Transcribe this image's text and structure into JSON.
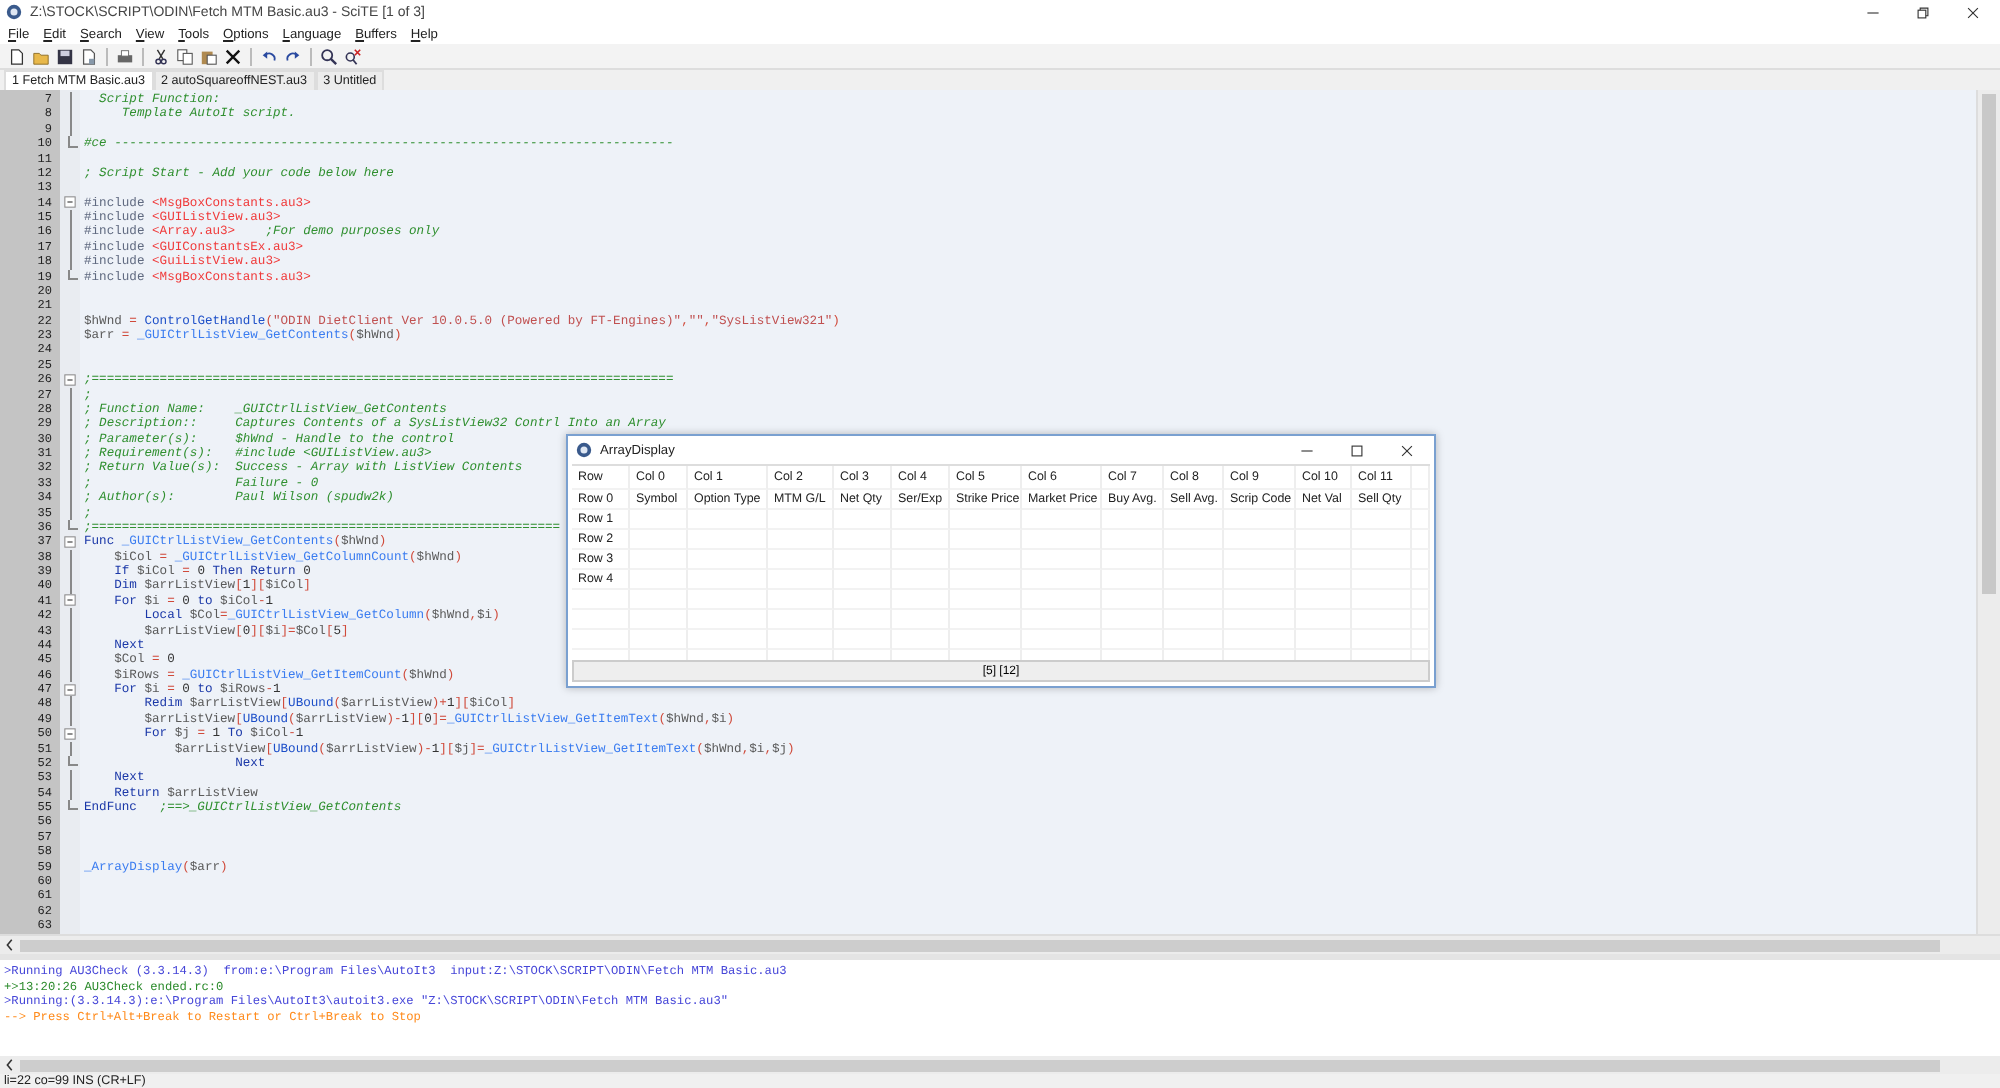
{
  "window": {
    "title": "Z:\\STOCK\\SCRIPT\\ODIN\\Fetch MTM Basic.au3 - SciTE [1 of 3]"
  },
  "menu": [
    "File",
    "Edit",
    "Search",
    "View",
    "Tools",
    "Options",
    "Language",
    "Buffers",
    "Help"
  ],
  "tabs": [
    {
      "label": "1 Fetch MTM Basic.au3",
      "selected": true
    },
    {
      "label": "2 autoSquareoffNEST.au3",
      "selected": false
    },
    {
      "label": "3 Untitled",
      "selected": false
    }
  ],
  "editor": {
    "lines": [
      {
        "num": "7",
        "kind": "fold_body",
        "tokens": [
          {
            "kind": "c",
            "text": "  Script Function:"
          }
        ]
      },
      {
        "num": "8",
        "kind": "fold_body",
        "tokens": [
          {
            "kind": "c",
            "text": "     Template AutoIt script."
          }
        ]
      },
      {
        "num": "9",
        "kind": "fold_body"
      },
      {
        "num": "10",
        "kind": "fold_end",
        "tokens": [
          {
            "kind": "c",
            "text": "#ce --------------------------------------------------------------------------"
          }
        ]
      },
      {
        "num": "11",
        "kind": "plain"
      },
      {
        "num": "12",
        "kind": "plain",
        "tokens": [
          {
            "kind": "c",
            "text": "; Script Start - Add your code below here"
          }
        ]
      },
      {
        "num": "13",
        "kind": "plain"
      },
      {
        "num": "14",
        "kind": "fold_start",
        "tokens": [
          {
            "kind": "d",
            "text": "#include "
          },
          {
            "kind": "inc",
            "text": "<MsgBoxConstants.au3>"
          }
        ]
      },
      {
        "num": "15",
        "kind": "fold_body",
        "tokens": [
          {
            "kind": "d",
            "text": "#include "
          },
          {
            "kind": "inc",
            "text": "<GUIListView.au3>"
          }
        ]
      },
      {
        "num": "16",
        "kind": "fold_body",
        "tokens": [
          {
            "kind": "d",
            "text": "#include "
          },
          {
            "kind": "inc",
            "text": "<Array.au3>"
          },
          {
            "kind": "c",
            "text": "    ;For demo purposes only"
          }
        ]
      },
      {
        "num": "17",
        "kind": "fold_body",
        "tokens": [
          {
            "kind": "d",
            "text": "#include "
          },
          {
            "kind": "inc",
            "text": "<GUIConstantsEx.au3>"
          }
        ]
      },
      {
        "num": "18",
        "kind": "fold_body",
        "tokens": [
          {
            "kind": "d",
            "text": "#include "
          },
          {
            "kind": "inc",
            "text": "<GuiListView.au3>"
          }
        ]
      },
      {
        "num": "19",
        "kind": "fold_end",
        "tokens": [
          {
            "kind": "d",
            "text": "#include "
          },
          {
            "kind": "inc",
            "text": "<MsgBoxConstants.au3>"
          }
        ]
      },
      {
        "num": "20",
        "kind": "plain"
      },
      {
        "num": "21",
        "kind": "plain"
      },
      {
        "num": "22",
        "kind": "plain",
        "tokens": [
          {
            "kind": "v",
            "text": "$hWnd"
          },
          {
            "kind": "o",
            "text": " = "
          },
          {
            "kind": "f",
            "text": "ControlGetHandle"
          },
          {
            "kind": "o",
            "text": "("
          },
          {
            "kind": "s",
            "text": "\"ODIN DietClient Ver 10.0.5.0 (Powered by FT-Engines)\""
          },
          {
            "kind": "o",
            "text": ","
          },
          {
            "kind": "s",
            "text": "\"\""
          },
          {
            "kind": "o",
            "text": ","
          },
          {
            "kind": "s",
            "text": "\"SysListView321\""
          },
          {
            "kind": "o",
            "text": ")"
          }
        ]
      },
      {
        "num": "23",
        "kind": "plain",
        "tokens": [
          {
            "kind": "v",
            "text": "$arr"
          },
          {
            "kind": "o",
            "text": " = "
          },
          {
            "kind": "u",
            "text": "_GUICtrlListView_GetContents"
          },
          {
            "kind": "o",
            "text": "("
          },
          {
            "kind": "v",
            "text": "$hWnd"
          },
          {
            "kind": "o",
            "text": ")"
          }
        ]
      },
      {
        "num": "24",
        "kind": "plain"
      },
      {
        "num": "25",
        "kind": "plain"
      },
      {
        "num": "26",
        "kind": "fold_start",
        "tokens": [
          {
            "kind": "c",
            "text": ";============================================================================="
          }
        ]
      },
      {
        "num": "27",
        "kind": "fold_body",
        "tokens": [
          {
            "kind": "c",
            "text": ";"
          }
        ]
      },
      {
        "num": "28",
        "kind": "fold_body",
        "tokens": [
          {
            "kind": "c",
            "text": "; Function Name:    _GUICtrlListView_GetContents"
          }
        ]
      },
      {
        "num": "29",
        "kind": "fold_body",
        "tokens": [
          {
            "kind": "c",
            "text": "; Description::     Captures Contents of a SysListView32 Contrl Into an Array"
          }
        ]
      },
      {
        "num": "30",
        "kind": "fold_body",
        "tokens": [
          {
            "kind": "c",
            "text": "; Parameter(s):     $hWnd - Handle to the control"
          }
        ]
      },
      {
        "num": "31",
        "kind": "fold_body",
        "tokens": [
          {
            "kind": "c",
            "text": "; Requirement(s):   #include <GUIListView.au3>"
          }
        ]
      },
      {
        "num": "32",
        "kind": "fold_body",
        "tokens": [
          {
            "kind": "c",
            "text": "; Return Value(s):  Success - Array with ListView Contents"
          }
        ]
      },
      {
        "num": "33",
        "kind": "fold_body",
        "tokens": [
          {
            "kind": "c",
            "text": ";                   Failure - 0"
          }
        ]
      },
      {
        "num": "34",
        "kind": "fold_body",
        "tokens": [
          {
            "kind": "c",
            "text": "; Author(s):        Paul Wilson (spudw2k)"
          }
        ]
      },
      {
        "num": "35",
        "kind": "fold_body",
        "tokens": [
          {
            "kind": "c",
            "text": ";"
          }
        ]
      },
      {
        "num": "36",
        "kind": "fold_end",
        "tokens": [
          {
            "kind": "c",
            "text": ";=============================================================="
          }
        ]
      },
      {
        "num": "37",
        "kind": "fold_start",
        "tokens": [
          {
            "kind": "k",
            "text": "Func "
          },
          {
            "kind": "u",
            "text": "_GUICtrlListView_GetContents"
          },
          {
            "kind": "o",
            "text": "("
          },
          {
            "kind": "v",
            "text": "$hWnd"
          },
          {
            "kind": "o",
            "text": ")"
          }
        ]
      },
      {
        "num": "38",
        "kind": "fold_body",
        "tokens": [
          {
            "kind": "v",
            "text": "    $iCol"
          },
          {
            "kind": "o",
            "text": " = "
          },
          {
            "kind": "u",
            "text": "_GUICtrlListView_GetColumnCount"
          },
          {
            "kind": "o",
            "text": "("
          },
          {
            "kind": "v",
            "text": "$hWnd"
          },
          {
            "kind": "o",
            "text": ")"
          }
        ]
      },
      {
        "num": "39",
        "kind": "fold_body",
        "tokens": [
          {
            "kind": "k",
            "text": "    If "
          },
          {
            "kind": "v",
            "text": "$iCol"
          },
          {
            "kind": "o",
            "text": " = "
          },
          {
            "kind": "n",
            "text": "0"
          },
          {
            "kind": "k",
            "text": " Then Return "
          },
          {
            "kind": "n",
            "text": "0"
          }
        ]
      },
      {
        "num": "40",
        "kind": "fold_body",
        "tokens": [
          {
            "kind": "k",
            "text": "    Dim "
          },
          {
            "kind": "v",
            "text": "$arrListView"
          },
          {
            "kind": "o",
            "text": "["
          },
          {
            "kind": "n",
            "text": "1"
          },
          {
            "kind": "o",
            "text": "]["
          },
          {
            "kind": "v",
            "text": "$iCol"
          },
          {
            "kind": "o",
            "text": "]"
          }
        ]
      },
      {
        "num": "41",
        "kind": "fold_start",
        "tokens": [
          {
            "kind": "k",
            "text": "    For "
          },
          {
            "kind": "v",
            "text": "$i"
          },
          {
            "kind": "o",
            "text": " = "
          },
          {
            "kind": "n",
            "text": "0"
          },
          {
            "kind": "k",
            "text": " to "
          },
          {
            "kind": "v",
            "text": "$iCol"
          },
          {
            "kind": "o",
            "text": "-"
          },
          {
            "kind": "n",
            "text": "1"
          }
        ]
      },
      {
        "num": "42",
        "kind": "fold_body",
        "tokens": [
          {
            "kind": "k",
            "text": "        Local "
          },
          {
            "kind": "v",
            "text": "$Col"
          },
          {
            "kind": "o",
            "text": "="
          },
          {
            "kind": "u",
            "text": "_GUICtrlListView_GetColumn"
          },
          {
            "kind": "o",
            "text": "("
          },
          {
            "kind": "v",
            "text": "$hWnd"
          },
          {
            "kind": "o",
            "text": ","
          },
          {
            "kind": "v",
            "text": "$i"
          },
          {
            "kind": "o",
            "text": ")"
          }
        ]
      },
      {
        "num": "43",
        "kind": "fold_body",
        "tokens": [
          {
            "kind": "v",
            "text": "        $arrListView"
          },
          {
            "kind": "o",
            "text": "["
          },
          {
            "kind": "n",
            "text": "0"
          },
          {
            "kind": "o",
            "text": "]["
          },
          {
            "kind": "v",
            "text": "$i"
          },
          {
            "kind": "o",
            "text": "]="
          },
          {
            "kind": "v",
            "text": "$Col"
          },
          {
            "kind": "o",
            "text": "["
          },
          {
            "kind": "n",
            "text": "5"
          },
          {
            "kind": "o",
            "text": "]"
          }
        ]
      },
      {
        "num": "44",
        "kind": "fold_body",
        "tokens": [
          {
            "kind": "k",
            "text": "    Next"
          }
        ]
      },
      {
        "num": "45",
        "kind": "fold_body",
        "tokens": [
          {
            "kind": "v",
            "text": "    $Col"
          },
          {
            "kind": "o",
            "text": " = "
          },
          {
            "kind": "n",
            "text": "0"
          }
        ]
      },
      {
        "num": "46",
        "kind": "fold_body",
        "tokens": [
          {
            "kind": "v",
            "text": "    $iRows"
          },
          {
            "kind": "o",
            "text": " = "
          },
          {
            "kind": "u",
            "text": "_GUICtrlListView_GetItemCount"
          },
          {
            "kind": "o",
            "text": "("
          },
          {
            "kind": "v",
            "text": "$hWnd"
          },
          {
            "kind": "o",
            "text": ")"
          }
        ]
      },
      {
        "num": "47",
        "kind": "fold_start",
        "tokens": [
          {
            "kind": "k",
            "text": "    For "
          },
          {
            "kind": "v",
            "text": "$i"
          },
          {
            "kind": "o",
            "text": " = "
          },
          {
            "kind": "n",
            "text": "0"
          },
          {
            "kind": "k",
            "text": " to "
          },
          {
            "kind": "v",
            "text": "$iRows"
          },
          {
            "kind": "o",
            "text": "-"
          },
          {
            "kind": "n",
            "text": "1"
          }
        ]
      },
      {
        "num": "48",
        "kind": "fold_body",
        "tokens": [
          {
            "kind": "k",
            "text": "        Redim "
          },
          {
            "kind": "v",
            "text": "$arrListView"
          },
          {
            "kind": "o",
            "text": "["
          },
          {
            "kind": "f",
            "text": "UBound"
          },
          {
            "kind": "o",
            "text": "("
          },
          {
            "kind": "v",
            "text": "$arrListView"
          },
          {
            "kind": "o",
            "text": ")+"
          },
          {
            "kind": "n",
            "text": "1"
          },
          {
            "kind": "o",
            "text": "]["
          },
          {
            "kind": "v",
            "text": "$iCol"
          },
          {
            "kind": "o",
            "text": "]"
          }
        ]
      },
      {
        "num": "49",
        "kind": "fold_body",
        "tokens": [
          {
            "kind": "v",
            "text": "        $arrListView"
          },
          {
            "kind": "o",
            "text": "["
          },
          {
            "kind": "f",
            "text": "UBound"
          },
          {
            "kind": "o",
            "text": "("
          },
          {
            "kind": "v",
            "text": "$arrListView"
          },
          {
            "kind": "o",
            "text": ")-"
          },
          {
            "kind": "n",
            "text": "1"
          },
          {
            "kind": "o",
            "text": "]["
          },
          {
            "kind": "n",
            "text": "0"
          },
          {
            "kind": "o",
            "text": "]="
          },
          {
            "kind": "u",
            "text": "_GUICtrlListView_GetItemText"
          },
          {
            "kind": "o",
            "text": "("
          },
          {
            "kind": "v",
            "text": "$hWnd"
          },
          {
            "kind": "o",
            "text": ","
          },
          {
            "kind": "v",
            "text": "$i"
          },
          {
            "kind": "o",
            "text": ")"
          }
        ]
      },
      {
        "num": "50",
        "kind": "fold_start",
        "tokens": [
          {
            "kind": "k",
            "text": "        For "
          },
          {
            "kind": "v",
            "text": "$j"
          },
          {
            "kind": "o",
            "text": " = "
          },
          {
            "kind": "n",
            "text": "1"
          },
          {
            "kind": "k",
            "text": " To "
          },
          {
            "kind": "v",
            "text": "$iCol"
          },
          {
            "kind": "o",
            "text": "-"
          },
          {
            "kind": "n",
            "text": "1"
          }
        ]
      },
      {
        "num": "51",
        "kind": "fold_body",
        "tokens": [
          {
            "kind": "v",
            "text": "            $arrListView"
          },
          {
            "kind": "o",
            "text": "["
          },
          {
            "kind": "f",
            "text": "UBound"
          },
          {
            "kind": "o",
            "text": "("
          },
          {
            "kind": "v",
            "text": "$arrListView"
          },
          {
            "kind": "o",
            "text": ")-"
          },
          {
            "kind": "n",
            "text": "1"
          },
          {
            "kind": "o",
            "text": "]["
          },
          {
            "kind": "v",
            "text": "$j"
          },
          {
            "kind": "o",
            "text": "]="
          },
          {
            "kind": "u",
            "text": "_GUICtrlListView_GetItemText"
          },
          {
            "kind": "o",
            "text": "("
          },
          {
            "kind": "v",
            "text": "$hWnd"
          },
          {
            "kind": "o",
            "text": ","
          },
          {
            "kind": "v",
            "text": "$i"
          },
          {
            "kind": "o",
            "text": ","
          },
          {
            "kind": "v",
            "text": "$j"
          },
          {
            "kind": "o",
            "text": ")"
          }
        ]
      },
      {
        "num": "52",
        "kind": "fold_end",
        "tokens": [
          {
            "kind": "k",
            "text": "                    Next"
          }
        ]
      },
      {
        "num": "53",
        "kind": "fold_body",
        "tokens": [
          {
            "kind": "k",
            "text": "    Next"
          }
        ]
      },
      {
        "num": "54",
        "kind": "fold_body",
        "tokens": [
          {
            "kind": "k",
            "text": "    Return "
          },
          {
            "kind": "v",
            "text": "$arrListView"
          }
        ]
      },
      {
        "num": "55",
        "kind": "fold_end",
        "tokens": [
          {
            "kind": "k",
            "text": "EndFunc"
          },
          {
            "kind": "c",
            "text": "   ;==>_GUICtrlListView_GetContents"
          }
        ]
      },
      {
        "num": "56",
        "kind": "plain"
      },
      {
        "num": "57",
        "kind": "plain"
      },
      {
        "num": "58",
        "kind": "plain"
      },
      {
        "num": "59",
        "kind": "plain",
        "tokens": [
          {
            "kind": "u",
            "text": "_ArrayDisplay"
          },
          {
            "kind": "o",
            "text": "("
          },
          {
            "kind": "v",
            "text": "$arr"
          },
          {
            "kind": "o",
            "text": ")"
          }
        ]
      },
      {
        "num": "60",
        "kind": "plain"
      },
      {
        "num": "61",
        "kind": "plain"
      },
      {
        "num": "62",
        "kind": "plain"
      },
      {
        "num": "63",
        "kind": "plain"
      }
    ]
  },
  "array_display": {
    "title": "ArrayDisplay",
    "columns": [
      "Row",
      "Col 0",
      "Col 1",
      "Col 2",
      "Col 3",
      "Col 4",
      "Col 5",
      "Col 6",
      "Col 7",
      "Col 8",
      "Col 9",
      "Col 10",
      "Col 11"
    ],
    "rows": [
      {
        "cells": [
          "Row 0",
          "Symbol",
          "Option Type",
          "MTM G/L",
          "Net Qty",
          "Ser/Exp",
          "Strike Price",
          "Market Price",
          "Buy Avg.",
          "Sell Avg.",
          "Scrip Code",
          "Net Val",
          "Sell Qty"
        ]
      },
      {
        "cells": [
          "Row 1"
        ]
      },
      {
        "cells": [
          "Row 2"
        ]
      },
      {
        "cells": [
          "Row 3"
        ]
      },
      {
        "cells": [
          "Row 4"
        ]
      }
    ],
    "status": "[5] [12]"
  },
  "output": [
    {
      "kind": "info",
      "text": ">Running AU3Check (3.3.14.3)  from:e:\\Program Files\\AutoIt3  input:Z:\\STOCK\\SCRIPT\\ODIN\\Fetch MTM Basic.au3"
    },
    {
      "kind": "ok",
      "text": "+>13:20:26 AU3Check ended.rc:0"
    },
    {
      "kind": "info",
      "text": ">Running:(3.3.14.3):e:\\Program Files\\AutoIt3\\autoit3.exe \"Z:\\STOCK\\SCRIPT\\ODIN\\Fetch MTM Basic.au3\""
    },
    {
      "kind": "warn",
      "text": "--> Press Ctrl+Alt+Break to Restart or Ctrl+Break to Stop"
    }
  ],
  "status_bar": "li=22 co=99 INS (CR+LF)"
}
